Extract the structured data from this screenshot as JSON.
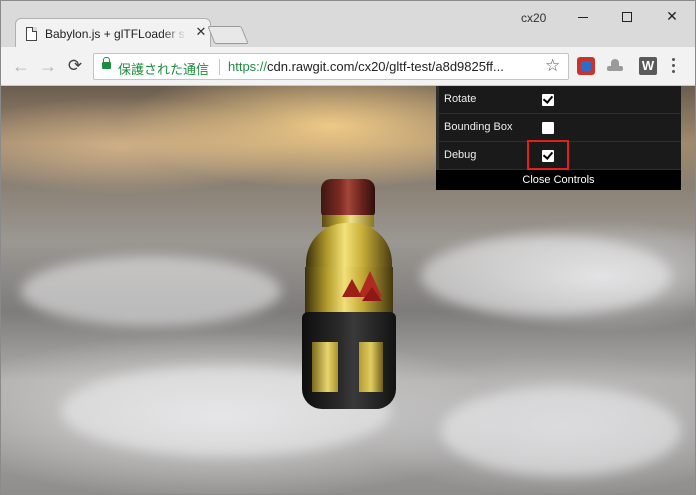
{
  "browser": {
    "tab": {
      "title": "Babylon.js + glTFLoader s",
      "favicon": "page-icon"
    },
    "profile_name": "cx20",
    "window_controls": {
      "minimize": "minimize",
      "maximize": "maximize",
      "close": "close"
    },
    "toolbar": {
      "back_icon": "←",
      "forward_icon": "→",
      "reload_icon": "⟳",
      "secure_label": "保護された通信",
      "url_scheme": "https://",
      "url_rest": "cdn.rawgit.com/cx20/gltf-test/a8d9825ff...",
      "bookmark_icon": "☆",
      "extensions": [
        "extension-1-icon",
        "extension-2-icon",
        "W"
      ]
    }
  },
  "scene": {
    "description_icon": "3d-bottle-model",
    "controls": [
      {
        "label": "Rotate",
        "checked": true
      },
      {
        "label": "Bounding Box",
        "checked": false
      },
      {
        "label": "Debug",
        "checked": true
      }
    ],
    "close_controls_label": "Close Controls",
    "highlight_color": "#e0201c"
  }
}
